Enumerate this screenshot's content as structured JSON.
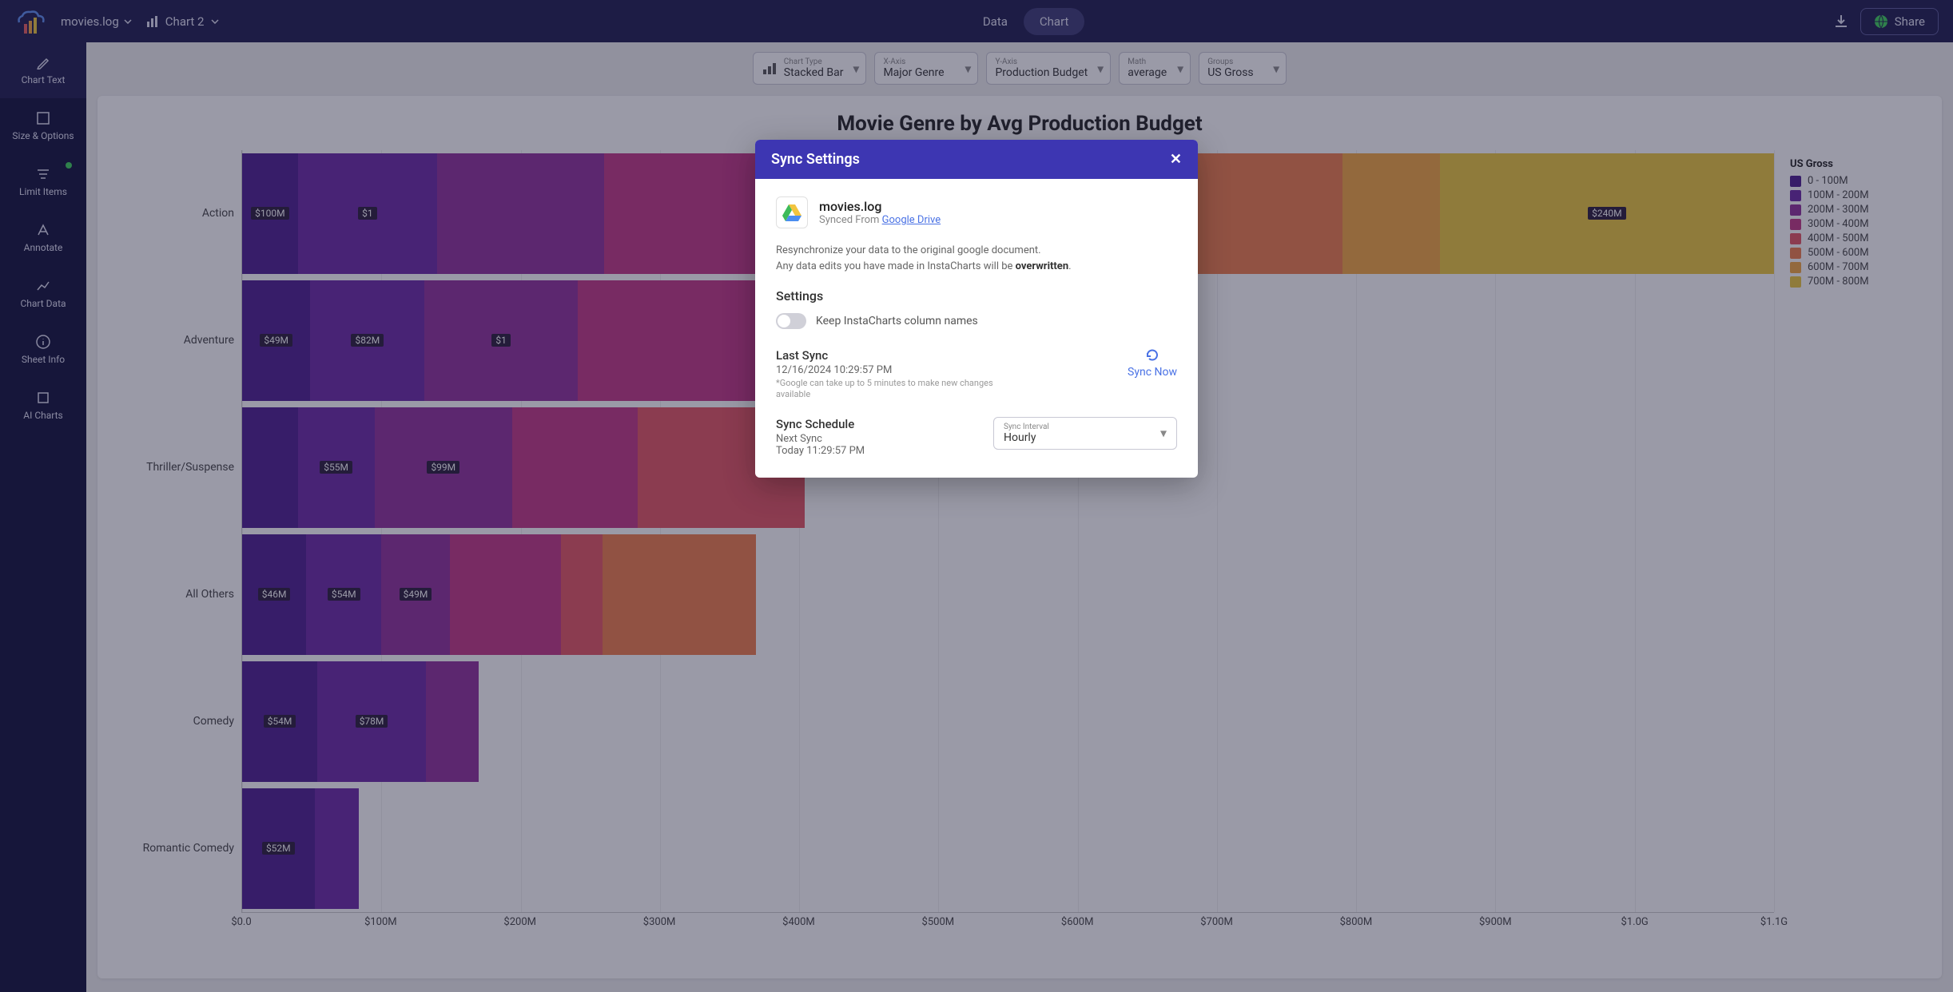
{
  "header": {
    "file_name": "movies.log",
    "chart_tab_label": "Chart 2",
    "tabs": {
      "data": "Data",
      "chart": "Chart",
      "active": "chart"
    },
    "share_label": "Share"
  },
  "sidebar": {
    "items": [
      {
        "id": "chart-text",
        "label": "Chart Text",
        "active": true,
        "dot": false
      },
      {
        "id": "size-options",
        "label": "Size & Options",
        "active": false,
        "dot": false
      },
      {
        "id": "limit-items",
        "label": "Limit Items",
        "active": false,
        "dot": true
      },
      {
        "id": "annotate",
        "label": "Annotate",
        "active": false,
        "dot": false
      },
      {
        "id": "chart-data",
        "label": "Chart Data",
        "active": false,
        "dot": false
      },
      {
        "id": "sheet-info",
        "label": "Sheet Info",
        "active": false,
        "dot": false
      },
      {
        "id": "ai-charts",
        "label": "AI Charts",
        "active": false,
        "dot": false
      }
    ]
  },
  "controls": {
    "chart_type": {
      "label": "Chart Type",
      "value": "Stacked Bar"
    },
    "x_axis": {
      "label": "X-Axis",
      "value": "Major Genre"
    },
    "y_axis": {
      "label": "Y-Axis",
      "value": "Production Budget"
    },
    "math": {
      "label": "Math",
      "value": "average"
    },
    "groups": {
      "label": "Groups",
      "value": "US Gross"
    }
  },
  "chart": {
    "title": "Movie Genre by Avg Production Budget",
    "legend_title": "US Gross",
    "legend": [
      {
        "label": "0 - 100M",
        "color": "#4b1d8f"
      },
      {
        "label": "100M - 200M",
        "color": "#6b27a4"
      },
      {
        "label": "200M - 300M",
        "color": "#8f2f9a"
      },
      {
        "label": "300M - 400M",
        "color": "#c13584"
      },
      {
        "label": "400M - 500M",
        "color": "#e45462"
      },
      {
        "label": "500M - 600M",
        "color": "#ef7d4a"
      },
      {
        "label": "600M - 700M",
        "color": "#f2a73e"
      },
      {
        "label": "700M - 800M",
        "color": "#ebc63b"
      }
    ],
    "x_ticks": [
      "$0.0",
      "$100M",
      "$200M",
      "$300M",
      "$400M",
      "$500M",
      "$600M",
      "$700M",
      "$800M",
      "$900M",
      "$1.0G",
      "$1.1G"
    ],
    "x_max": 1100
  },
  "chart_data": {
    "type": "bar",
    "orientation": "horizontal",
    "stacked": true,
    "xlabel": "",
    "ylabel": "",
    "xlim": [
      0,
      1100
    ],
    "units": "M USD",
    "group_field": "US Gross",
    "categories": [
      "Action",
      "Adventure",
      "Thriller/Suspense",
      "All Others",
      "Comedy",
      "Romantic Comedy"
    ],
    "series": [
      {
        "name": "0 - 100M",
        "color": "#4b1d8f",
        "values": [
          40,
          49,
          40,
          46,
          54,
          52
        ]
      },
      {
        "name": "100M - 200M",
        "color": "#6b27a4",
        "values": [
          100,
          82,
          55,
          54,
          78,
          32
        ]
      },
      {
        "name": "200M - 300M",
        "color": "#8f2f9a",
        "values": [
          120,
          110,
          99,
          49,
          38,
          0
        ]
      },
      {
        "name": "300M - 400M",
        "color": "#c13584",
        "values": [
          180,
          130,
          90,
          80,
          0,
          0
        ]
      },
      {
        "name": "400M - 500M",
        "color": "#e45462",
        "values": [
          180,
          150,
          120,
          30,
          0,
          0
        ]
      },
      {
        "name": "500M - 600M",
        "color": "#ef7d4a",
        "values": [
          170,
          100,
          0,
          110,
          0,
          0
        ]
      },
      {
        "name": "600M - 700M",
        "color": "#f2a73e",
        "values": [
          70,
          0,
          0,
          0,
          0,
          0
        ]
      },
      {
        "name": "700M - 800M",
        "color": "#ebc63b",
        "values": [
          240,
          0,
          0,
          0,
          0,
          0
        ]
      }
    ],
    "visible_labels": {
      "Action": [
        "$100M",
        "$1",
        "",
        "",
        "",
        "",
        "",
        "$240M"
      ],
      "Adventure": [
        "$49M",
        "$82M",
        "$1",
        "",
        "",
        "",
        "",
        ""
      ],
      "Thriller/Suspense": [
        "",
        "$55M",
        "$99M",
        "",
        "",
        "",
        "",
        ""
      ],
      "All Others": [
        "$46M",
        "$54M",
        "$49M",
        "",
        "",
        "",
        "",
        ""
      ],
      "Comedy": [
        "$54M",
        "$78M",
        "",
        "",
        "",
        "",
        "",
        ""
      ],
      "Romantic Comedy": [
        "$52M",
        "",
        "",
        "",
        "",
        "",
        "",
        ""
      ]
    }
  },
  "modal": {
    "title": "Sync Settings",
    "file_name": "movies.log",
    "synced_from_label": "Synced From",
    "synced_from_link": "Google Drive",
    "resync_text_1": "Resynchronize your data to the original google document.",
    "resync_text_2a": "Any data edits you have made in InstaCharts will be ",
    "resync_text_2b": "overwritten",
    "settings_heading": "Settings",
    "toggle_label": "Keep InstaCharts column names",
    "toggle_on": false,
    "last_sync_heading": "Last Sync",
    "last_sync_ts": "12/16/2024 10:29:57 PM",
    "last_sync_note": "*Google can take up to 5 minutes to make new changes available",
    "sync_now_label": "Sync Now",
    "schedule_heading": "Sync Schedule",
    "next_sync_label": "Next Sync",
    "next_sync_ts": "Today 11:29:57 PM",
    "interval_label": "Sync Interval",
    "interval_value": "Hourly"
  }
}
